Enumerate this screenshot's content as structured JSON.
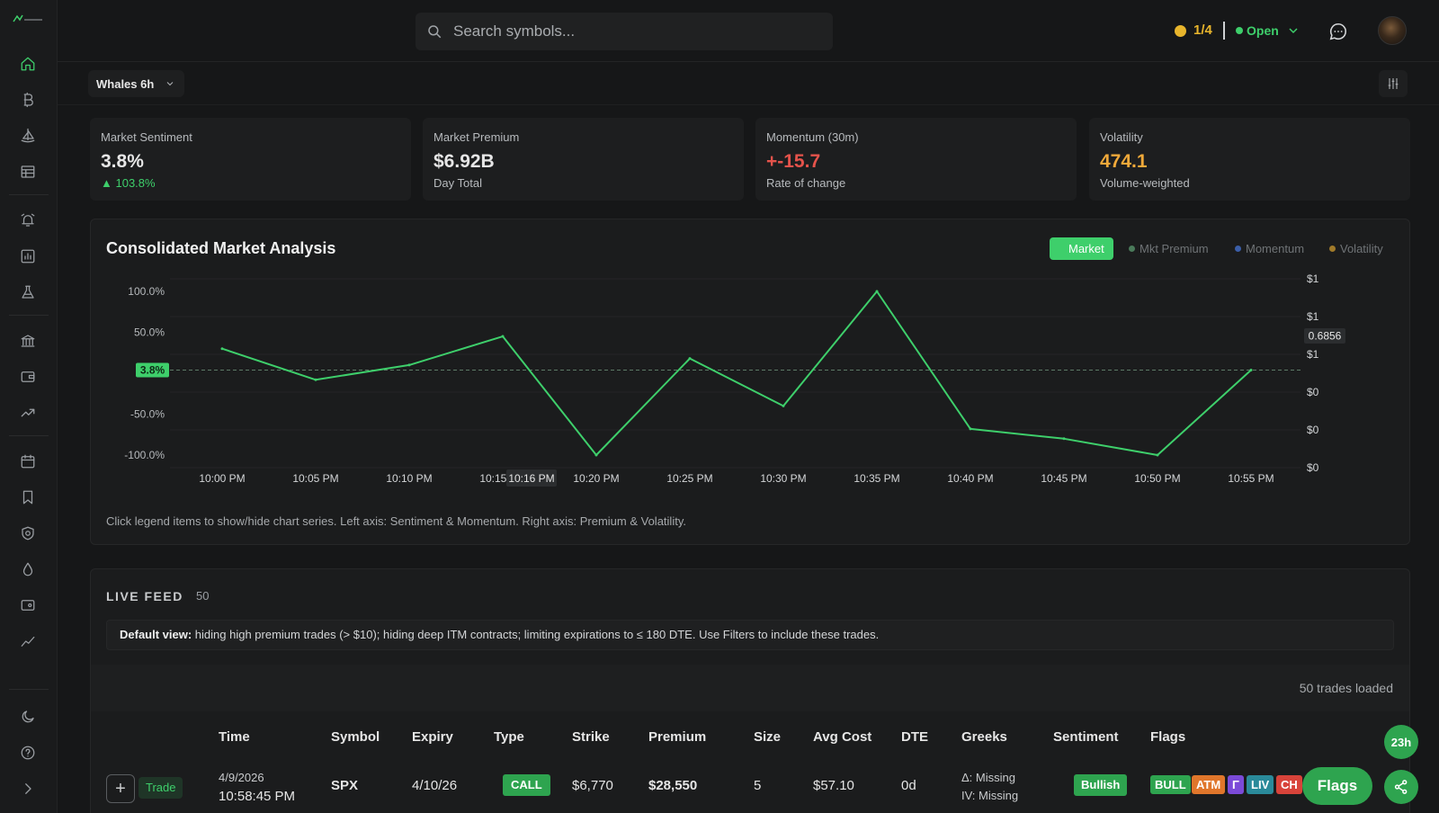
{
  "search": {
    "placeholder": "Search symbols..."
  },
  "topbar": {
    "counter": "1/4",
    "market_status": "Open"
  },
  "subbar": {
    "view_select": "Whales 6h"
  },
  "metrics": [
    {
      "label": "Market Sentiment",
      "value": "3.8%",
      "sub": "▲ 103.8%"
    },
    {
      "label": "Market Premium",
      "value": "$6.92B",
      "sub": "Day Total"
    },
    {
      "label": "Momentum (30m)",
      "value": "+-15.7",
      "sub": "Rate of change"
    },
    {
      "label": "Volatility",
      "value": "474.1",
      "sub": "Volume-weighted"
    }
  ],
  "chart_panel": {
    "title": "Consolidated Market Analysis",
    "legend": [
      "Market",
      "Mkt Premium",
      "Momentum",
      "Volatility"
    ],
    "note": "Click legend items to show/hide chart series. Left axis: Sentiment & Momentum. Right axis: Premium & Volatility.",
    "current_marker": "3.8%",
    "hover_time": "10:16 PM",
    "right_axis_marker": "0.6856"
  },
  "chart_data": {
    "type": "line",
    "x": [
      "10:00 PM",
      "10:05 PM",
      "10:10 PM",
      "10:15 PM",
      "10:20 PM",
      "10:25 PM",
      "10:30 PM",
      "10:35 PM",
      "10:40 PM",
      "10:45 PM",
      "10:50 PM",
      "10:55 PM"
    ],
    "series": [
      {
        "name": "Market",
        "values": [
          30,
          -8,
          10,
          45,
          -100,
          18,
          -40,
          100,
          -68,
          -80,
          -100,
          3.8
        ],
        "color": "#3ecf6b"
      }
    ],
    "left_ticks": [
      "100.0%",
      "50.0%",
      "-50.0%",
      "-100.0%"
    ],
    "right_ticks": [
      "$1",
      "$1",
      "$1",
      "$0",
      "$0",
      "$0"
    ],
    "ylim": [
      -100,
      100
    ],
    "reference_line": 3.8
  },
  "feed": {
    "title": "LIVE FEED",
    "count": "50",
    "info_bold": "Default view:",
    "info_text": " hiding high premium trades (> $10); hiding deep ITM contracts; limiting expirations to ≤ 180 DTE. Use Filters to include these trades.",
    "loaded": "50 trades loaded",
    "columns": [
      "Time",
      "Symbol",
      "Expiry",
      "Type",
      "Strike",
      "Premium",
      "Size",
      "Avg Cost",
      "DTE",
      "Greeks",
      "Sentiment",
      "Flags"
    ],
    "rows": [
      {
        "trade_label": "Trade",
        "date": "4/9/2026",
        "time": "10:58:45 PM",
        "symbol": "SPX",
        "expiry": "4/10/26",
        "type": "CALL",
        "strike": "$6,770",
        "premium": "$28,550",
        "size": "5",
        "avg_cost": "$57.10",
        "dte": "0d",
        "greeks_delta": "Δ: Missing",
        "greeks_iv": "IV: Missing",
        "sentiment": "Bullish",
        "flags": [
          "BULL",
          "ATM",
          "Γ",
          "LIV",
          "CH"
        ]
      }
    ]
  },
  "floating": {
    "timer": "23h",
    "flags": "Flags"
  },
  "colors": {
    "accent": "#3ecf6b",
    "negative": "#e5534b",
    "warning": "#f0a93a"
  }
}
